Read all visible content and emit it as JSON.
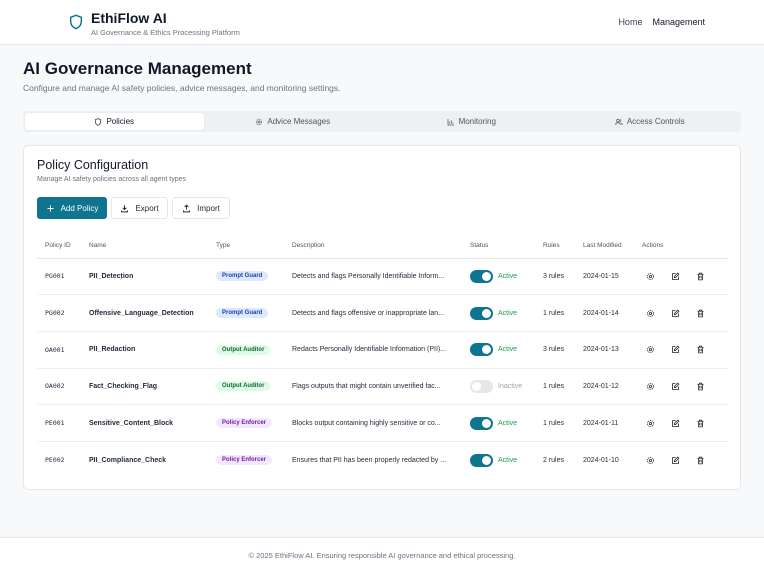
{
  "header": {
    "brand_name": "EthiFlow AI",
    "brand_sub": "AI Governance & Ethics Processing Platform",
    "brand_icon": "shield-icon",
    "nav": [
      "Home",
      "Management"
    ]
  },
  "page": {
    "title": "AI Governance Management",
    "subtitle": "Configure and manage AI safety policies, advice messages, and monitoring settings."
  },
  "tabs": [
    {
      "label": "Policies",
      "icon": "shield-icon",
      "active": true
    },
    {
      "label": "Advice Messages",
      "icon": "gear-icon",
      "active": false
    },
    {
      "label": "Monitoring",
      "icon": "bar-chart-icon",
      "active": false
    },
    {
      "label": "Access Controls",
      "icon": "users-icon",
      "active": false
    }
  ],
  "card": {
    "title": "Policy Configuration",
    "subtitle": "Manage AI safety policies across all agent types",
    "buttons": {
      "add": "Add Policy",
      "export": "Export",
      "import": "Import"
    }
  },
  "table": {
    "headers": [
      "Policy ID",
      "Name",
      "Type",
      "Description",
      "Status",
      "Rules",
      "Last Modified",
      "Actions"
    ],
    "rows": [
      {
        "id": "PG001",
        "name": "PII_Detection",
        "type": "Prompt Guard",
        "type_key": "pg",
        "description": "Detects and flags Personally Identifiable Inform...",
        "status": "Active",
        "on": true,
        "rules": "3 rules",
        "modified": "2024-01-15"
      },
      {
        "id": "PG002",
        "name": "Offensive_Language_Detection",
        "type": "Prompt Guard",
        "type_key": "pg",
        "description": "Detects and flags offensive or inappropriate lan...",
        "status": "Active",
        "on": true,
        "rules": "1 rules",
        "modified": "2024-01-14"
      },
      {
        "id": "OA001",
        "name": "PII_Redaction",
        "type": "Output Auditor",
        "type_key": "oa",
        "description": "Redacts Personally Identifiable Information (PII)...",
        "status": "Active",
        "on": true,
        "rules": "3 rules",
        "modified": "2024-01-13"
      },
      {
        "id": "OA002",
        "name": "Fact_Checking_Flag",
        "type": "Output Auditor",
        "type_key": "oa",
        "description": "Flags outputs that might contain unverified fac...",
        "status": "Inactive",
        "on": false,
        "rules": "1 rules",
        "modified": "2024-01-12"
      },
      {
        "id": "PE001",
        "name": "Sensitive_Content_Block",
        "type": "Policy Enforcer",
        "type_key": "pe",
        "description": "Blocks output containing highly sensitive or co...",
        "status": "Active",
        "on": true,
        "rules": "1 rules",
        "modified": "2024-01-11"
      },
      {
        "id": "PE002",
        "name": "PII_Compliance_Check",
        "type": "Policy Enforcer",
        "type_key": "pe",
        "description": "Ensures that PII has been properly redacted by ...",
        "status": "Active",
        "on": true,
        "rules": "2 rules",
        "modified": "2024-01-10"
      }
    ],
    "action_icons": [
      "gear-icon",
      "edit-icon",
      "trash-icon"
    ]
  },
  "footer": {
    "text": "© 2025 EthiFlow AI. Ensuring responsible AI governance and ethical processing."
  },
  "colors": {
    "primary": "#0e7490",
    "active_text": "#16a34a",
    "inactive_text": "#9ca3af",
    "prompt_guard_bg": "#dbeafe",
    "output_auditor_bg": "#dcfce7",
    "policy_enforcer_bg": "#f3e8ff"
  }
}
